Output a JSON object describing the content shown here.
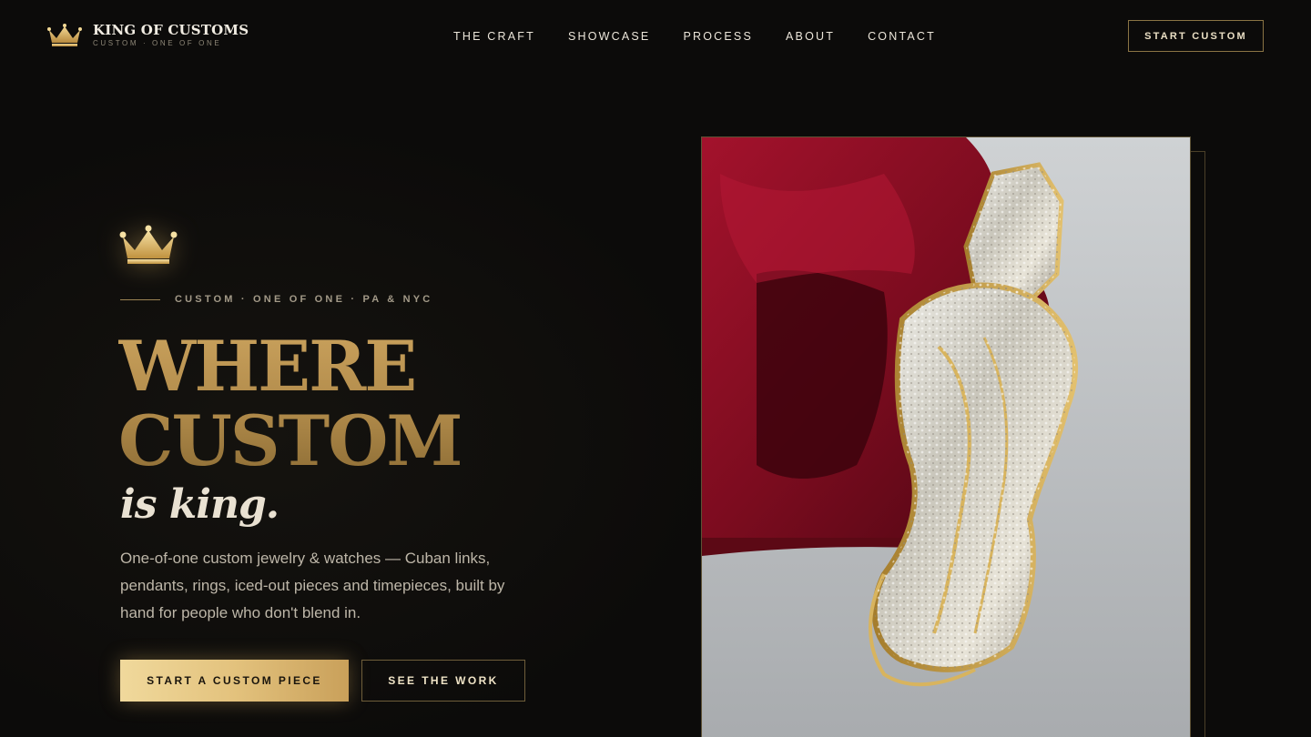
{
  "brand": {
    "title": "KING OF CUSTOMS",
    "subtitle": "CUSTOM · ONE OF ONE",
    "icon": "crown-icon"
  },
  "nav": {
    "items": [
      {
        "label": "THE CRAFT"
      },
      {
        "label": "SHOWCASE"
      },
      {
        "label": "PROCESS"
      },
      {
        "label": "ABOUT"
      },
      {
        "label": "CONTACT"
      }
    ],
    "cta_label": "START CUSTOM"
  },
  "hero": {
    "icon": "crown-icon",
    "eyebrow": "CUSTOM · ONE OF ONE · PA & NYC",
    "headline_line1": "WHERE",
    "headline_line2": "CUSTOM",
    "tagline": "is king.",
    "description": "One-of-one custom jewelry & watches — Cuban links, pendants, rings, iced-out pieces and timepieces, built by hand for people who don't blend in.",
    "primary_button": "START A CUSTOM PIECE",
    "secondary_button": "SEE THE WORK",
    "image_icon": "iced-pendant-photo"
  },
  "colors": {
    "background": "#0c0b0a",
    "gold": "#c9a15c",
    "gold_light": "#f0d99c",
    "text": "#e8e2d6",
    "velvet": "#8a0f22"
  }
}
